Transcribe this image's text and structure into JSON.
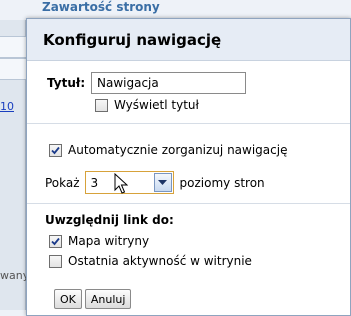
{
  "background": {
    "heading": "Zawartość strony",
    "link_fragment": "10",
    "text_fragment": "wany"
  },
  "dialog": {
    "title": "Konfiguruj nawigację",
    "title_label": "Tytuł:",
    "title_value": "Nawigacja",
    "show_title_label": "Wyświetl tytuł",
    "show_title_checked": false,
    "auto_organize_label": "Automatycznie zorganizuj nawigację",
    "auto_organize_checked": true,
    "show_prefix": "Pokaż",
    "levels_value": "3",
    "levels_suffix": "poziomy stron",
    "include_heading": "Uwzględnij link do:",
    "sitemap_label": "Mapa witryny",
    "sitemap_checked": true,
    "recent_activity_label": "Ostatnia aktywność w witrynie",
    "recent_activity_checked": false,
    "ok_label": "OK",
    "cancel_label": "Anuluj"
  },
  "icons": {
    "check": "check-icon",
    "dropdown": "chevron-down-icon",
    "cursor": "mouse-pointer-icon"
  }
}
